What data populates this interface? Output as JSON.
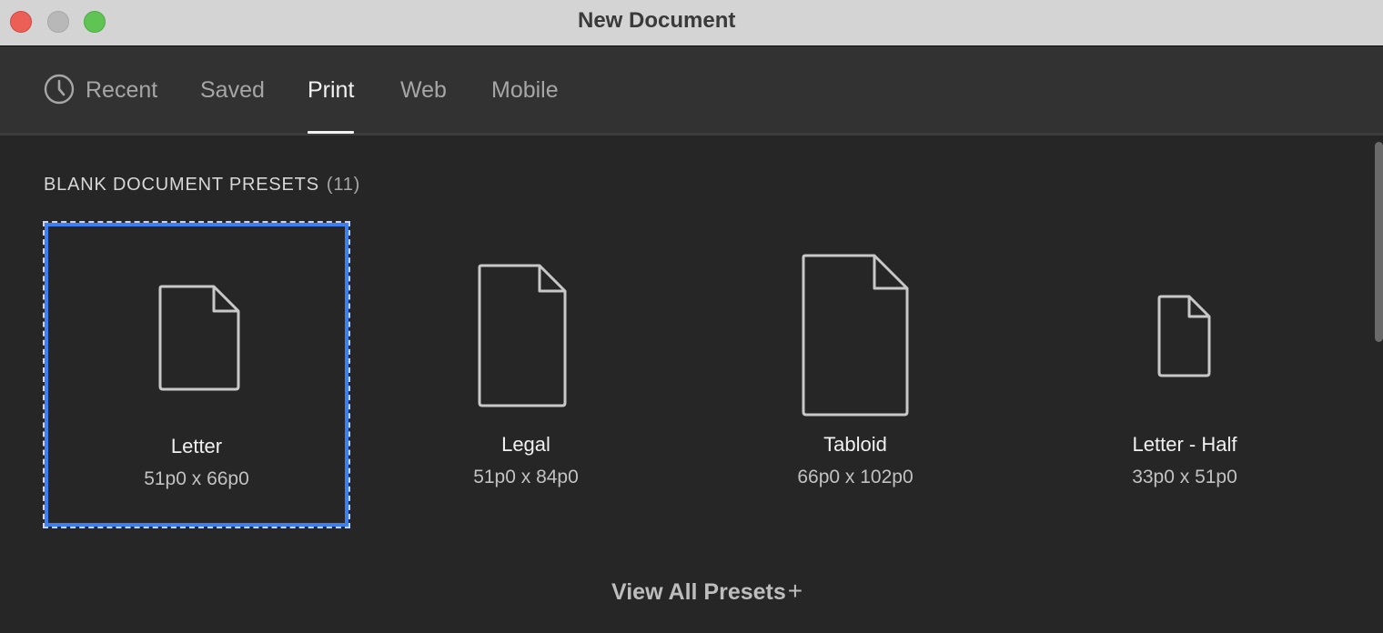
{
  "window": {
    "title": "New Document"
  },
  "tabs": [
    {
      "label": "Recent",
      "icon": "clock-icon"
    },
    {
      "label": "Saved"
    },
    {
      "label": "Print",
      "active": true
    },
    {
      "label": "Web"
    },
    {
      "label": "Mobile"
    }
  ],
  "section": {
    "heading": "BLANK DOCUMENT PRESETS",
    "count": "(11)"
  },
  "presets": [
    {
      "name": "Letter",
      "size": "51p0 x 66p0",
      "selected": true,
      "icon": "document-icon"
    },
    {
      "name": "Legal",
      "size": "51p0 x 84p0",
      "icon": "document-icon"
    },
    {
      "name": "Tabloid",
      "size": "66p0 x 102p0",
      "icon": "document-icon"
    },
    {
      "name": "Letter - Half",
      "size": "33p0 x 51p0",
      "icon": "document-icon"
    }
  ],
  "view_all": {
    "label": "View All Presets",
    "plus": "+"
  },
  "colors": {
    "background": "#262626",
    "tabbar": "#323232",
    "selection_outline": "#3d7ef0",
    "active_tab": "#f2f2f2",
    "inactive_tab": "#a6a6a6"
  }
}
